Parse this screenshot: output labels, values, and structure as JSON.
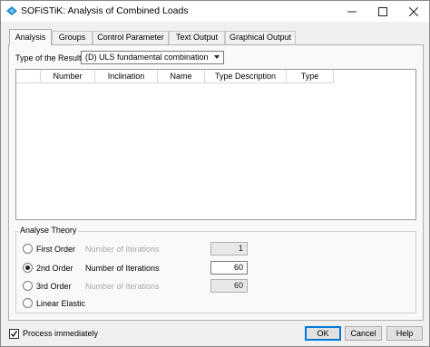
{
  "window": {
    "title": "SOFiSTiK: Analysis of Combined Loads",
    "icon": "sofistik-logo-icon",
    "controls": [
      "minimize-icon",
      "maximize-icon",
      "close-icon"
    ]
  },
  "tabs": [
    {
      "label": "Analysis",
      "active": true
    },
    {
      "label": "Groups",
      "active": false
    },
    {
      "label": "Control Parameter",
      "active": false
    },
    {
      "label": "Text Output",
      "active": false
    },
    {
      "label": "Graphical Output",
      "active": false
    }
  ],
  "result_type": {
    "label": "Type of the Result:",
    "selected": "(D)  ULS fundamental combination"
  },
  "table": {
    "columns": [
      "",
      "Number",
      "Inclination",
      "Name",
      "Type Description",
      "Type"
    ],
    "rows": []
  },
  "analyse_theory": {
    "title": "Analyse Theory",
    "options": [
      {
        "label": "First Order",
        "selected": false,
        "iter_label": "Number of Iterations",
        "iter_value": "1",
        "enabled": false
      },
      {
        "label": "2nd Order",
        "selected": true,
        "iter_label": "Number of Iterations",
        "iter_value": "60",
        "enabled": true
      },
      {
        "label": "3rd Order",
        "selected": false,
        "iter_label": "Number of Iterations",
        "iter_value": "60",
        "enabled": false
      },
      {
        "label": "Linear Elastic",
        "selected": false
      }
    ]
  },
  "footer": {
    "process_label": "Process immediately",
    "process_checked": true,
    "ok": "OK",
    "cancel": "Cancel",
    "help": "Help"
  },
  "colors": {
    "accent": "#0078d7",
    "logo": "#1e90d0"
  }
}
